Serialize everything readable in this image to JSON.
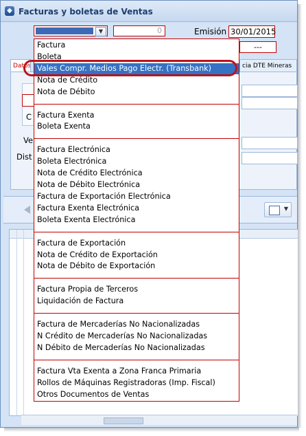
{
  "window": {
    "title": "Facturas y boletas de Ventas"
  },
  "form": {
    "number_value": "0",
    "emision_label": "Emisión",
    "emision_date": "30/01/2015",
    "aux_value": "---"
  },
  "tabs": [
    {
      "label": "Datos"
    },
    {
      "label": "cia DTE Mineras"
    }
  ],
  "panel": {
    "labels": [
      "C",
      "C",
      "Ve",
      "Dist"
    ]
  },
  "dropdown": {
    "selected_index": 2,
    "groups": [
      [
        "Factura",
        "Boleta",
        "Vales Compr. Medios Pago Electr. (Transbank)",
        "Nota de Crédito",
        "Nota de Débito"
      ],
      [
        "Factura Exenta",
        "Boleta Exenta"
      ],
      [
        "Factura Electrónica",
        "Boleta Electrónica",
        "Nota de Crédito Electrónica",
        "Nota de Débito Electrónica",
        "Factura de Exportación Electrónica",
        "Factura Exenta Electrónica",
        "Boleta Exenta Electrónica"
      ],
      [
        "Factura de Exportación",
        "Nota de Crédito de Exportación",
        "Nota de Débito de Exportación"
      ],
      [
        "Factura Propia de Terceros",
        "Liquidación de Factura"
      ],
      [
        "Factura de Mercaderías No Nacionalizadas",
        "N Crédito de Mercaderías No Nacionalizadas",
        "N Débito de Mercaderías No Nacionalizadas"
      ],
      [
        "Factura Vta Exenta a Zona Franca Primaria",
        "Rollos de Máquinas Registradoras (Imp. Fiscal)",
        "Otros Documentos de Ventas"
      ]
    ]
  },
  "colors": {
    "accent_red": "#c00000",
    "selection_blue": "#3572c4",
    "window_bg": "#d4e3f5"
  }
}
